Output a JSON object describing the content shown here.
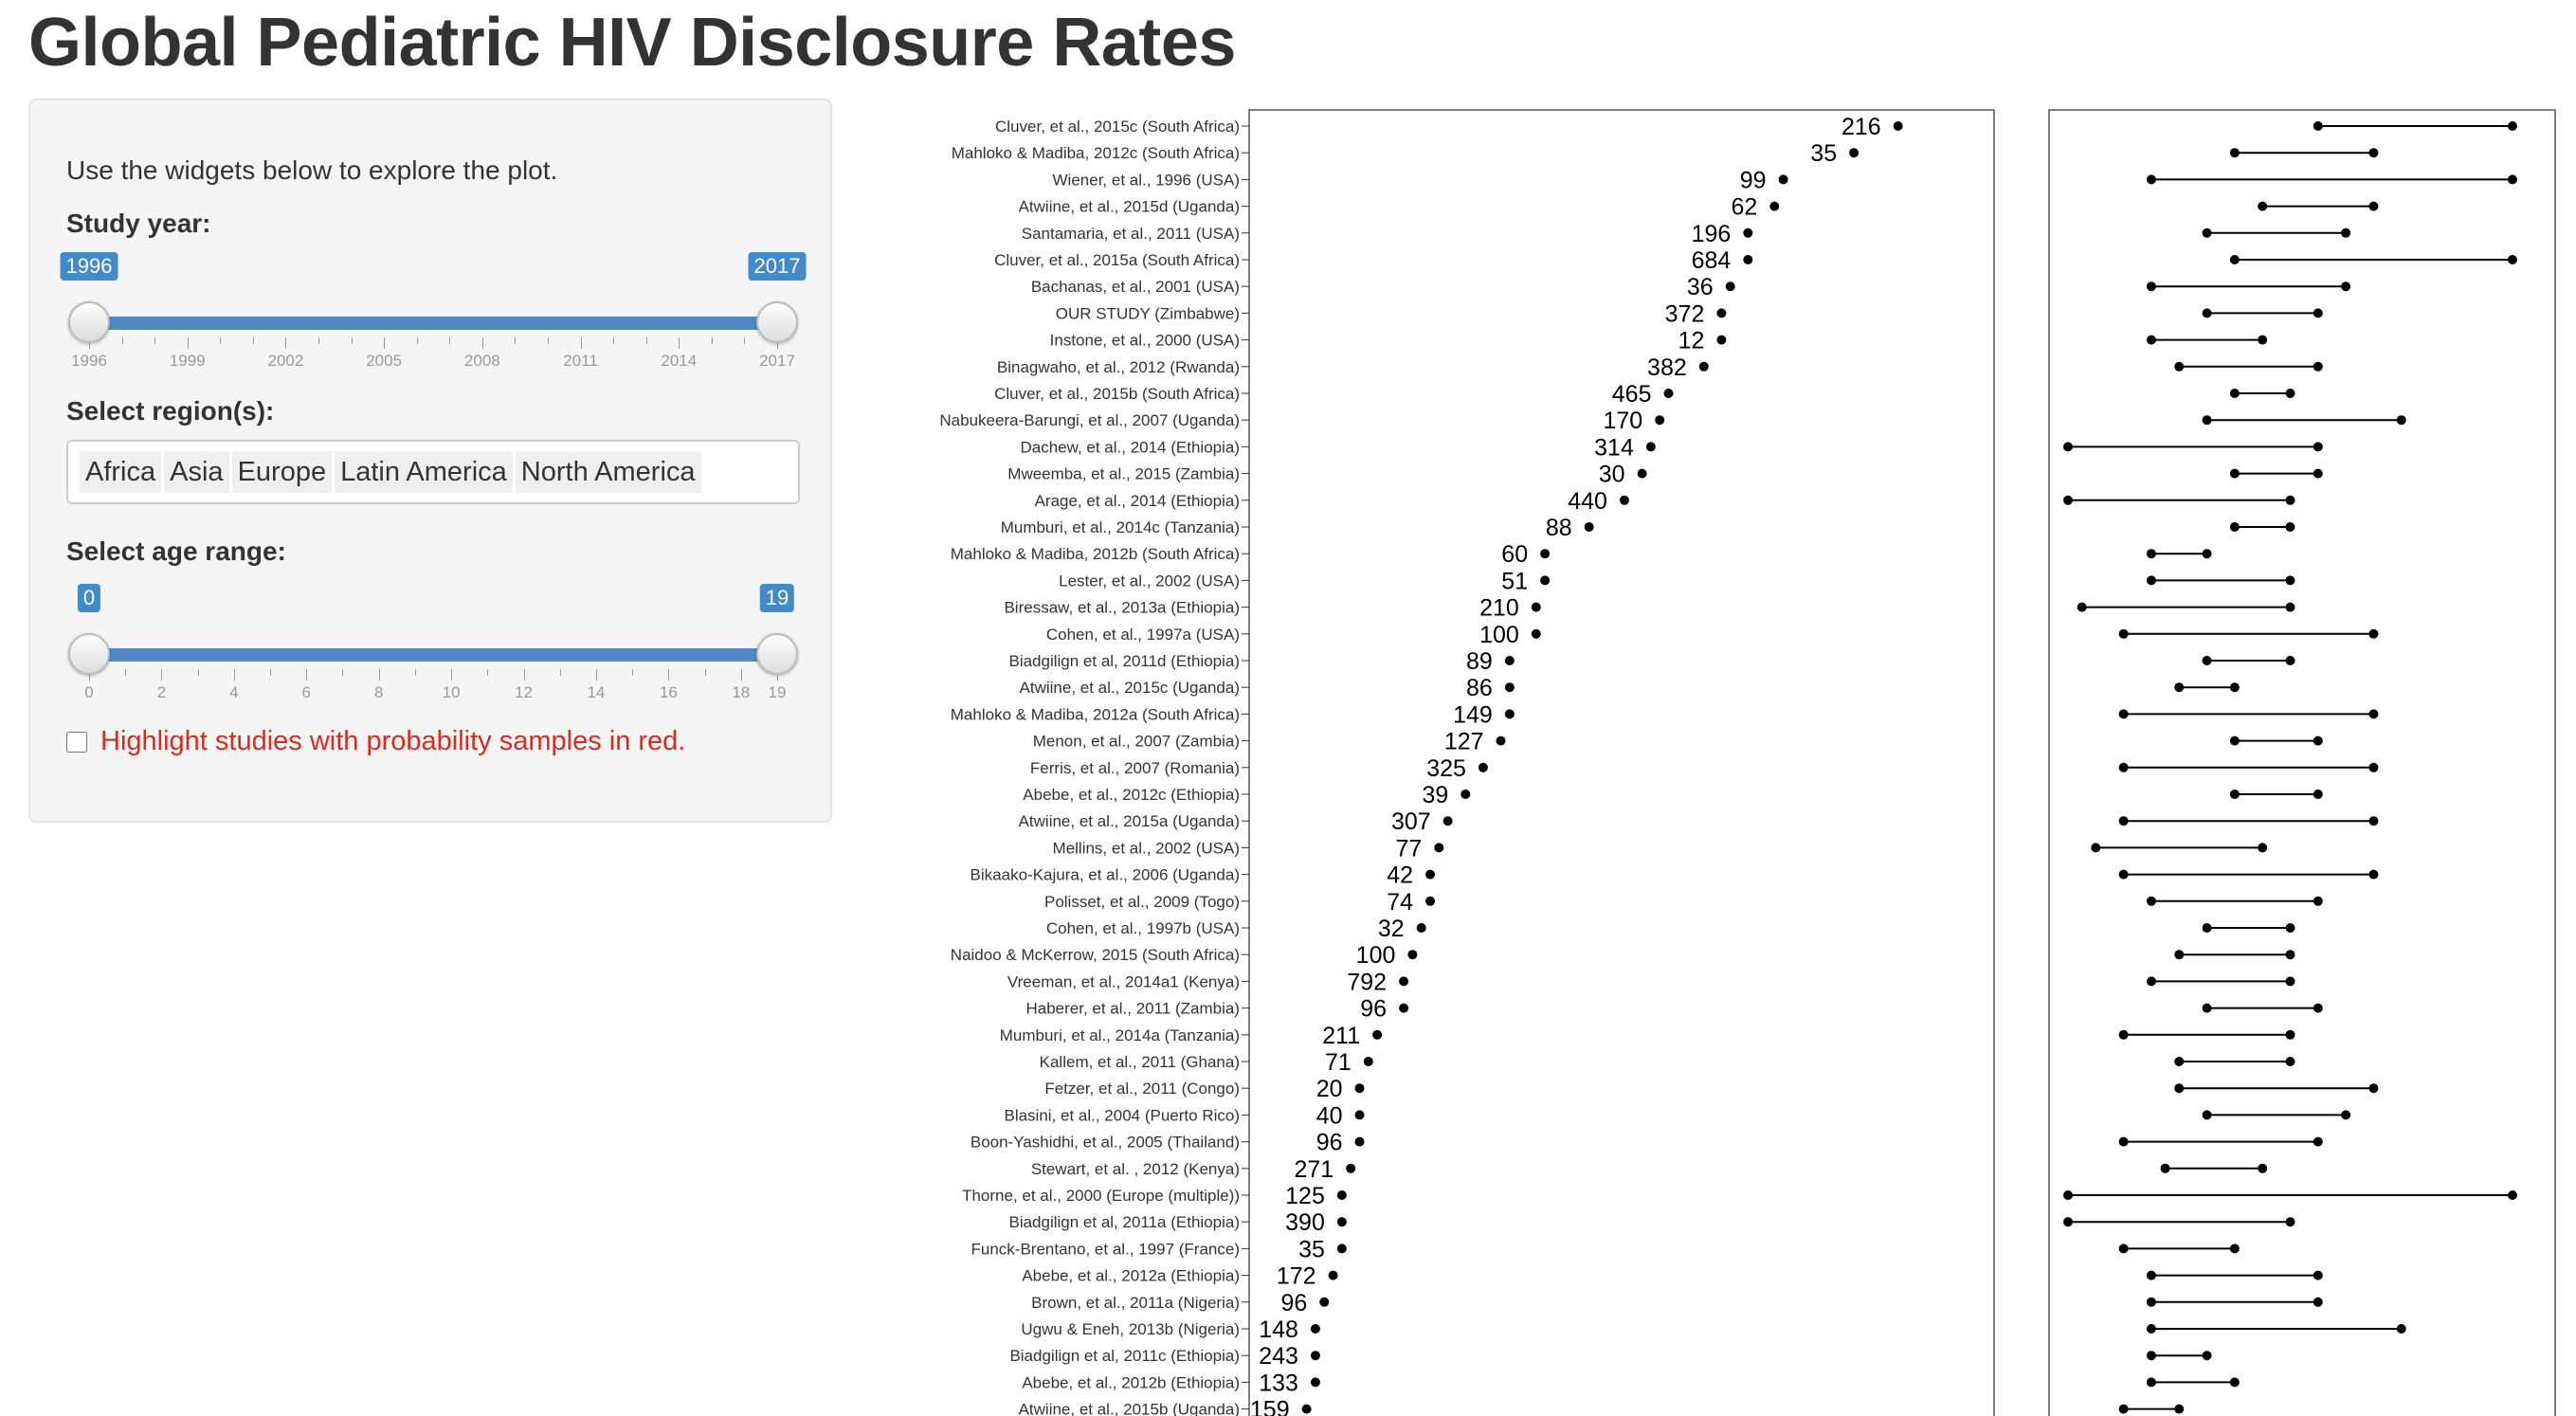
{
  "title": "Global Pediatric HIV Disclosure Rates",
  "sidebar": {
    "intro": "Use the widgets below to explore the plot.",
    "year_label": "Study year:",
    "year_min": "1996",
    "year_max": "2017",
    "year_ticks": [
      "1996",
      "1999",
      "2002",
      "2005",
      "2008",
      "2011",
      "2014",
      "2017"
    ],
    "region_label": "Select region(s):",
    "regions": [
      "Africa",
      "Asia",
      "Europe",
      "Latin America",
      "North America"
    ],
    "age_label": "Select age range:",
    "age_min": "0",
    "age_max": "19",
    "age_ticks": [
      "0",
      "2",
      "4",
      "6",
      "8",
      "10",
      "12",
      "14",
      "16",
      "18",
      "19"
    ],
    "checkbox_label": "Highlight studies with probability samples in red."
  },
  "colors": {
    "accent": "#428bca",
    "track": "#4f8ac6",
    "highlight": "#e0281c"
  },
  "chart_data": {
    "type": "scatter",
    "disclosure_rate_rank_order": "descending",
    "studies": [
      {
        "name": "Cluver, et al., 2015c (South Africa)",
        "n": 216,
        "rate": 0.89,
        "age": [
          9,
          16
        ]
      },
      {
        "name": "Mahloko & Madiba, 2012c (South Africa)",
        "n": 35,
        "rate": 0.84,
        "age": [
          6,
          11
        ]
      },
      {
        "name": "Wiener, et al., 1996 (USA)",
        "n": 99,
        "rate": 0.76,
        "age": [
          3,
          16
        ]
      },
      {
        "name": "Atwiine, et al., 2015d (Uganda)",
        "n": 62,
        "rate": 0.75,
        "age": [
          7,
          11
        ]
      },
      {
        "name": "Santamaria, et al., 2011 (USA)",
        "n": 196,
        "rate": 0.72,
        "age": [
          5,
          10
        ]
      },
      {
        "name": "Cluver, et al., 2015a (South Africa)",
        "n": 684,
        "rate": 0.72,
        "age": [
          6,
          16
        ]
      },
      {
        "name": "Bachanas, et al., 2001 (USA)",
        "n": 36,
        "rate": 0.7,
        "age": [
          3,
          10
        ]
      },
      {
        "name": "OUR STUDY (Zimbabwe)",
        "n": 372,
        "rate": 0.69,
        "age": [
          5,
          9
        ]
      },
      {
        "name": "Instone, et al., 2000 (USA)",
        "n": 12,
        "rate": 0.69,
        "age": [
          3,
          7
        ]
      },
      {
        "name": "Binagwaho, et al., 2012 (Rwanda)",
        "n": 382,
        "rate": 0.67,
        "age": [
          4,
          9
        ]
      },
      {
        "name": "Cluver, et al., 2015b (South Africa)",
        "n": 465,
        "rate": 0.63,
        "age": [
          6,
          8
        ]
      },
      {
        "name": "Nabukeera-Barungi, et al., 2007 (Uganda)",
        "n": 170,
        "rate": 0.62,
        "age": [
          5,
          12
        ]
      },
      {
        "name": "Dachew, et al., 2014 (Ethiopia)",
        "n": 314,
        "rate": 0.61,
        "age": [
          0,
          9
        ]
      },
      {
        "name": "Mweemba, et al., 2015 (Zambia)",
        "n": 30,
        "rate": 0.6,
        "age": [
          6,
          9
        ]
      },
      {
        "name": "Arage, et al., 2014 (Ethiopia)",
        "n": 440,
        "rate": 0.58,
        "age": [
          0,
          8
        ]
      },
      {
        "name": "Mumburi, et al., 2014c (Tanzania)",
        "n": 88,
        "rate": 0.54,
        "age": [
          6,
          8
        ]
      },
      {
        "name": "Mahloko & Madiba, 2012b (South Africa)",
        "n": 60,
        "rate": 0.49,
        "age": [
          3,
          5
        ]
      },
      {
        "name": "Lester, et al., 2002 (USA)",
        "n": 51,
        "rate": 0.49,
        "age": [
          3,
          8
        ]
      },
      {
        "name": "Biressaw, et al., 2013a (Ethiopia)",
        "n": 210,
        "rate": 0.48,
        "age": [
          0.5,
          8
        ]
      },
      {
        "name": "Cohen, et al., 1997a (USA)",
        "n": 100,
        "rate": 0.48,
        "age": [
          2,
          11
        ]
      },
      {
        "name": "Biadgilign et al, 2011d (Ethiopia)",
        "n": 89,
        "rate": 0.45,
        "age": [
          5,
          8
        ]
      },
      {
        "name": "Atwiine, et al., 2015c (Uganda)",
        "n": 86,
        "rate": 0.45,
        "age": [
          4,
          6
        ]
      },
      {
        "name": "Mahloko & Madiba, 2012a (South Africa)",
        "n": 149,
        "rate": 0.45,
        "age": [
          2,
          11
        ]
      },
      {
        "name": "Menon, et al., 2007 (Zambia)",
        "n": 127,
        "rate": 0.44,
        "age": [
          6,
          9
        ]
      },
      {
        "name": "Ferris, et al., 2007 (Romania)",
        "n": 325,
        "rate": 0.42,
        "age": [
          2,
          11
        ]
      },
      {
        "name": "Abebe, et al., 2012c (Ethiopia)",
        "n": 39,
        "rate": 0.4,
        "age": [
          6,
          9
        ]
      },
      {
        "name": "Atwiine, et al., 2015a (Uganda)",
        "n": 307,
        "rate": 0.38,
        "age": [
          2,
          11
        ]
      },
      {
        "name": "Mellins, et al., 2002 (USA)",
        "n": 77,
        "rate": 0.37,
        "age": [
          1,
          7
        ]
      },
      {
        "name": "Bikaako-Kajura, et al., 2006 (Uganda)",
        "n": 42,
        "rate": 0.36,
        "age": [
          2,
          11
        ]
      },
      {
        "name": "Polisset, et al., 2009 (Togo)",
        "n": 74,
        "rate": 0.36,
        "age": [
          3,
          9
        ]
      },
      {
        "name": "Cohen, et al., 1997b (USA)",
        "n": 32,
        "rate": 0.35,
        "age": [
          5,
          8
        ]
      },
      {
        "name": "Naidoo & McKerrow, 2015 (South Africa)",
        "n": 100,
        "rate": 0.34,
        "age": [
          4,
          8
        ]
      },
      {
        "name": "Vreeman, et al., 2014a1 (Kenya)",
        "n": 792,
        "rate": 0.33,
        "age": [
          3,
          8
        ]
      },
      {
        "name": "Haberer, et al., 2011 (Zambia)",
        "n": 96,
        "rate": 0.33,
        "age": [
          5,
          9
        ]
      },
      {
        "name": "Mumburi, et al., 2014a (Tanzania)",
        "n": 211,
        "rate": 0.3,
        "age": [
          2,
          8
        ]
      },
      {
        "name": "Kallem, et al., 2011 (Ghana)",
        "n": 71,
        "rate": 0.29,
        "age": [
          4,
          8
        ]
      },
      {
        "name": "Fetzer, et al., 2011 (Congo)",
        "n": 20,
        "rate": 0.28,
        "age": [
          4,
          11
        ]
      },
      {
        "name": "Blasini, et al., 2004 (Puerto Rico)",
        "n": 40,
        "rate": 0.28,
        "age": [
          5,
          10
        ]
      },
      {
        "name": "Boon-Yashidhi, et al., 2005 (Thailand)",
        "n": 96,
        "rate": 0.28,
        "age": [
          2,
          9
        ]
      },
      {
        "name": "Stewart, et al. , 2012 (Kenya)",
        "n": 271,
        "rate": 0.27,
        "age": [
          3.5,
          7
        ]
      },
      {
        "name": "Thorne, et al., 2000 (Europe (multiple))",
        "n": 125,
        "rate": 0.26,
        "age": [
          0,
          16
        ]
      },
      {
        "name": "Biadgilign et al, 2011a (Ethiopia)",
        "n": 390,
        "rate": 0.26,
        "age": [
          0,
          8
        ]
      },
      {
        "name": "Funck-Brentano, et al., 1997 (France)",
        "n": 35,
        "rate": 0.26,
        "age": [
          2,
          6
        ]
      },
      {
        "name": "Abebe, et al., 2012a (Ethiopia)",
        "n": 172,
        "rate": 0.25,
        "age": [
          3,
          9
        ]
      },
      {
        "name": "Brown, et al., 2011a (Nigeria)",
        "n": 96,
        "rate": 0.24,
        "age": [
          3,
          9
        ]
      },
      {
        "name": "Ugwu & Eneh, 2013b (Nigeria)",
        "n": 148,
        "rate": 0.23,
        "age": [
          3,
          12
        ]
      },
      {
        "name": "Biadgilign et al, 2011c (Ethiopia)",
        "n": 243,
        "rate": 0.23,
        "age": [
          3,
          5
        ]
      },
      {
        "name": "Abebe, et al., 2012b (Ethiopia)",
        "n": 133,
        "rate": 0.23,
        "age": [
          3,
          6
        ]
      },
      {
        "name": "Atwiine, et al., 2015b (Uganda)",
        "n": 159,
        "rate": 0.22,
        "age": [
          2,
          4
        ]
      }
    ]
  }
}
